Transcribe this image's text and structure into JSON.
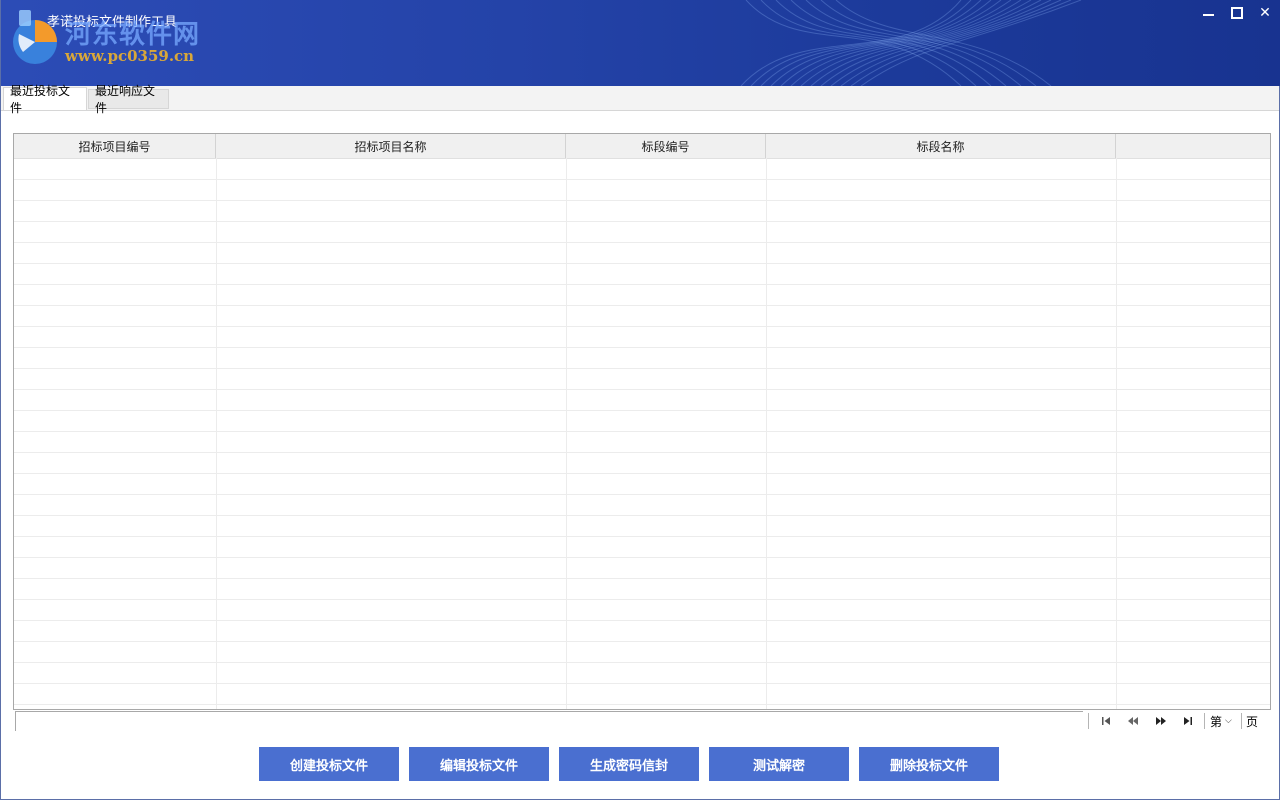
{
  "window": {
    "title": "孝诺投标文件制作工具",
    "watermark_name": "河东软件网",
    "watermark_url": "www.pc0359.cn",
    "controls": {
      "minimize": "minimize-icon",
      "maximize": "maximize-icon",
      "close": "✕"
    }
  },
  "tabs": [
    {
      "label": "最近投标文件",
      "active": true
    },
    {
      "label": "最近响应文件",
      "active": false
    }
  ],
  "table": {
    "columns": [
      "招标项目编号",
      "招标项目名称",
      "标段编号",
      "标段名称",
      ""
    ],
    "rows": []
  },
  "pager": {
    "first_icon": "first-page-icon",
    "prev_icon": "prev-page-icon",
    "next_icon": "next-page-icon",
    "last_icon": "last-page-icon",
    "page_prefix": "第",
    "page_value": "",
    "page_suffix": "页"
  },
  "actions": {
    "create": "创建投标文件",
    "edit": "编辑投标文件",
    "generate": "生成密码信封",
    "test_decrypt": "测试解密",
    "delete": "删除投标文件"
  },
  "colors": {
    "title_bg": "#2443a8",
    "button_bg": "#4a6fd0",
    "header_bg": "#f0f0f0"
  }
}
